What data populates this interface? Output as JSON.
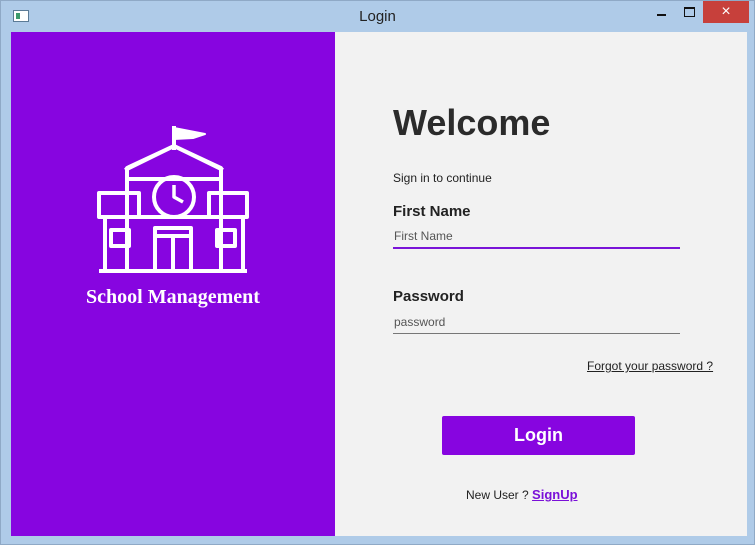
{
  "window": {
    "title": "Login",
    "controls": {
      "minimize": "minimize-icon",
      "maximize": "maximize-icon",
      "close": "×"
    }
  },
  "brand": {
    "app_name": "School Management",
    "icon": "school-building-icon"
  },
  "form": {
    "heading": "Welcome",
    "subtitle": "Sign in to continue",
    "first_name_label": "First Name",
    "first_name_placeholder": "First Name",
    "password_label": "Password",
    "password_placeholder": "password",
    "forgot_link": "Forgot your password ?",
    "login_button": "Login",
    "new_user_text": "New User ?",
    "signup_link": "SignUp"
  },
  "colors": {
    "accent": "#8705e0",
    "panel_background": "#f2f2f2",
    "close_button": "#c7403b"
  }
}
